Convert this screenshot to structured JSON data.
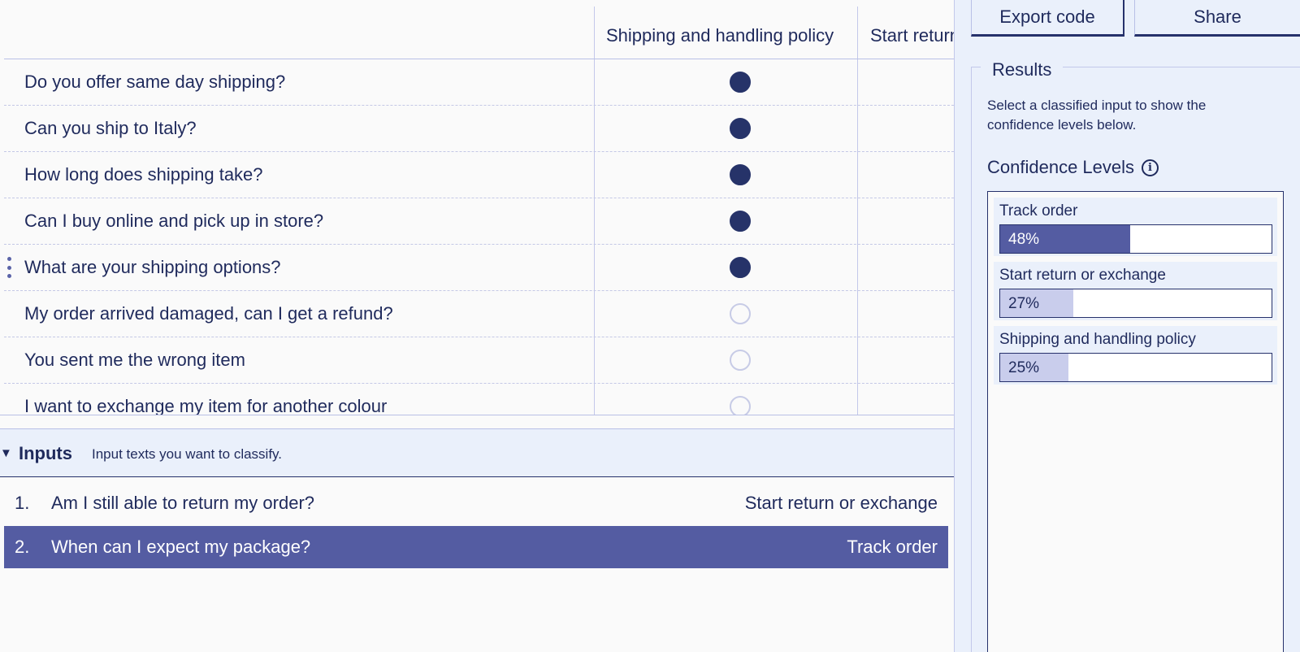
{
  "table": {
    "columns": [
      "Shipping and handling policy",
      "Start return or exchange"
    ],
    "rows": [
      {
        "text": "Do you offer same day shipping?",
        "shipping": true
      },
      {
        "text": "Can you ship to Italy?",
        "shipping": true
      },
      {
        "text": "How long does shipping take?",
        "shipping": true
      },
      {
        "text": "Can I buy online and pick up in store?",
        "shipping": true
      },
      {
        "text": "What are your shipping options?",
        "shipping": true
      },
      {
        "text": "My order arrived damaged, can I get a refund?",
        "shipping": false
      },
      {
        "text": "You sent me the wrong item",
        "shipping": false
      },
      {
        "text": "I want to exchange my item for another colour",
        "shipping": false
      }
    ]
  },
  "inputs": {
    "title": "Inputs",
    "description": "Input texts you want to classify.",
    "items": [
      {
        "num": "1.",
        "text": "Am I still able to return my order?",
        "label": "Start return or exchange",
        "selected": false
      },
      {
        "num": "2.",
        "text": "When can I expect my package?",
        "label": "Track order",
        "selected": true
      }
    ]
  },
  "toolbar": {
    "export_label": "Export code",
    "share_label": "Share"
  },
  "results": {
    "legend": "Results",
    "description": "Select a classified input to show the confidence levels below.",
    "confidence_heading": "Confidence Levels",
    "levels": [
      {
        "label": "Track order",
        "percent_text": "48%",
        "value": 0.48
      },
      {
        "label": "Start return or exchange",
        "percent_text": "27%",
        "value": 0.27
      },
      {
        "label": "Shipping and handling policy",
        "percent_text": "25%",
        "value": 0.25
      }
    ]
  },
  "colors": {
    "accent": "#545ca2",
    "dark": "#263369",
    "light_fill": "#c9cdec",
    "panel_bg": "#eaf0fb"
  },
  "icons": {
    "info": "info-icon",
    "drag": "drag-handle-icon",
    "collapse": "collapse-triangle-icon"
  }
}
